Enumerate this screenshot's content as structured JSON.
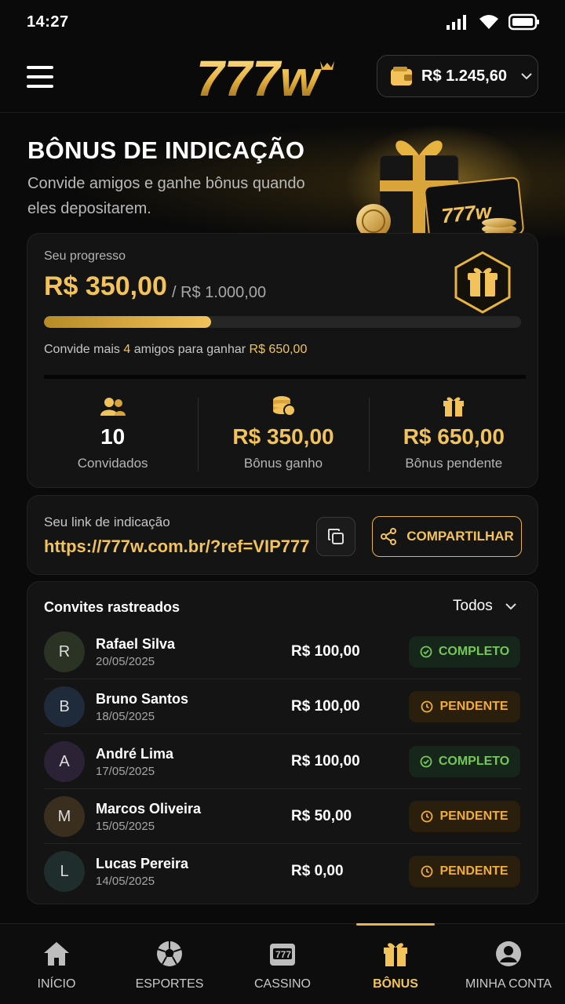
{
  "status": {
    "time": "14:27"
  },
  "header": {
    "logo_text": "777w",
    "wallet_balance": "R$ 1.245,60"
  },
  "hero": {
    "title": "BÔNUS DE INDICAÇÃO",
    "subtitle": "Convide amigos e ganhe bônus quando eles depositarem.",
    "art_label": "777w"
  },
  "progress": {
    "label": "Seu progresso",
    "current": "R$ 350,00",
    "target": "/ R$ 1.000,00",
    "fraction": 0.35,
    "hint_prefix": "Convide mais",
    "hint_count": "4",
    "hint_middle": "amigos para ganhar",
    "hint_amount": "R$ 650,00"
  },
  "stats": [
    {
      "icon": "users-icon",
      "value": "10",
      "label": "Convidados"
    },
    {
      "icon": "coins-icon",
      "value": "R$ 350,00",
      "label": "Bônus ganho"
    },
    {
      "icon": "gift-icon",
      "value": "R$ 650,00",
      "label": "Bônus pendente"
    }
  ],
  "referral": {
    "label": "Seu link de indicação",
    "url": "https://777w.com.br/?ref=VIP777",
    "share_label": "COMPARTILHAR"
  },
  "invites": {
    "title": "Convites rastreados",
    "filter": "Todos",
    "rows": [
      {
        "initial": "R",
        "name": "Rafael Silva",
        "date": "20/05/2025",
        "amount": "R$ 100,00",
        "status": "COMPLETO",
        "avatar_color": "#2a3324"
      },
      {
        "initial": "B",
        "name": "Bruno Santos",
        "date": "18/05/2025",
        "amount": "R$ 100,00",
        "status": "PENDENTE",
        "avatar_color": "#1f2b3a"
      },
      {
        "initial": "A",
        "name": "André Lima",
        "date": "17/05/2025",
        "amount": "R$ 100,00",
        "status": "COMPLETO",
        "avatar_color": "#2b2236"
      },
      {
        "initial": "M",
        "name": "Marcos Oliveira",
        "date": "15/05/2025",
        "amount": "R$ 50,00",
        "status": "PENDENTE",
        "avatar_color": "#3a2f1f"
      },
      {
        "initial": "L",
        "name": "Lucas Pereira",
        "date": "14/05/2025",
        "amount": "R$ 0,00",
        "status": "PENDENTE",
        "avatar_color": "#1f2e2c"
      }
    ]
  },
  "nav": [
    {
      "icon": "home-icon",
      "label": "INÍCIO",
      "active": false
    },
    {
      "icon": "soccer-ball-icon",
      "label": "ESPORTES",
      "active": false
    },
    {
      "icon": "slot-machine-icon",
      "label": "CASSINO",
      "active": false
    },
    {
      "icon": "gift-icon",
      "label": "BÔNUS",
      "active": true
    },
    {
      "icon": "user-icon",
      "label": "MINHA CONTA",
      "active": false
    }
  ],
  "colors": {
    "accent": "#f2c35a",
    "success": "#73c857",
    "warning": "#f0ad3c",
    "background": "#0a0a0a"
  }
}
